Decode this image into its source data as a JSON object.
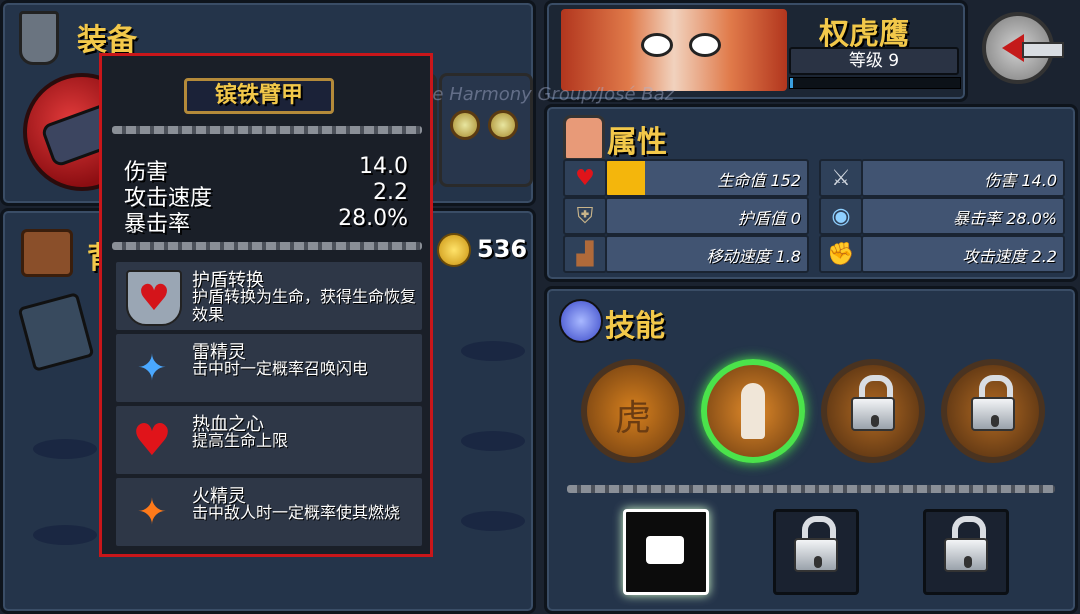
{
  "equipment": {
    "title": "装备"
  },
  "backpack": {
    "title": "背包",
    "coins": "536"
  },
  "tooltip": {
    "item_name": "镔铁臂甲",
    "stats": [
      {
        "label": "伤害",
        "value": "14.0"
      },
      {
        "label": "攻击速度",
        "value": "2.2"
      },
      {
        "label": "暴击率",
        "value": "28.0%"
      }
    ],
    "effects": [
      {
        "name": "护盾转换",
        "desc": "护盾转换为生命，获得生命恢复效果",
        "icon": "shield-heart-icon"
      },
      {
        "name": "雷精灵",
        "desc": "击中时一定概率召唤闪电",
        "icon": "thunder-sprite-icon"
      },
      {
        "name": "热血之心",
        "desc": "提高生命上限",
        "icon": "heart-icon"
      },
      {
        "name": "火精灵",
        "desc": "击中敌人时一定概率使其燃烧",
        "icon": "fire-sprite-icon"
      }
    ]
  },
  "watermark": "Theme - The Harmony Group/José Baz",
  "character": {
    "name": "权虎鹰",
    "level_label": "等级 9",
    "xp_progress": 0.02
  },
  "attributes": {
    "title": "属性",
    "items": [
      {
        "label": "生命值 152",
        "icon": "heart-icon",
        "fill": 0.19
      },
      {
        "label": "伤害 14.0",
        "icon": "sword-icon",
        "fill": 0
      },
      {
        "label": "护盾值 0",
        "icon": "shield-icon",
        "fill": 0
      },
      {
        "label": "暴击率 28.0%",
        "icon": "eye-icon",
        "fill": 0
      },
      {
        "label": "移动速度 1.8",
        "icon": "boot-icon",
        "fill": 0
      },
      {
        "label": "攻击速度 2.2",
        "icon": "fist-icon",
        "fill": 0
      }
    ]
  },
  "skills": {
    "title": "技能",
    "passive": [
      {
        "name": "tiger-skill",
        "locked": false,
        "glyph": "虎"
      },
      {
        "name": "figure-skill",
        "locked": false,
        "selected": true
      },
      {
        "name": "locked-skill-1",
        "locked": true
      },
      {
        "name": "locked-skill-2",
        "locked": true
      }
    ],
    "active": [
      {
        "name": "punch-skill",
        "locked": false
      },
      {
        "name": "locked-active-1",
        "locked": true
      },
      {
        "name": "locked-active-2",
        "locked": true
      }
    ]
  },
  "colors": {
    "gold": "#f2c84a",
    "tooltip_border": "#c9161a",
    "health_bar": "#f4b60c",
    "selected_glow": "#4be34b"
  }
}
